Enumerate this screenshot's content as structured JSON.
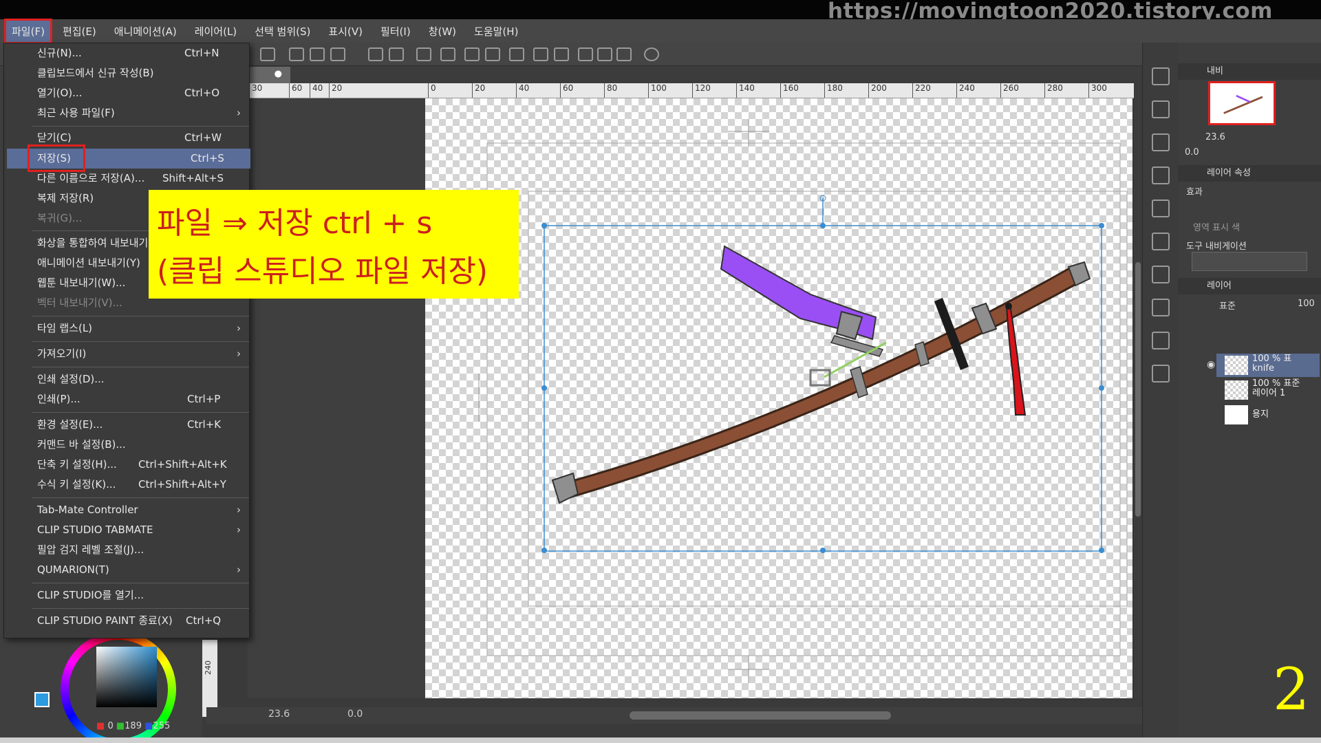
{
  "watermark": "https://movingtoon2020.tistory.com",
  "menubar": {
    "items": [
      "파일(F)",
      "편집(E)",
      "애니메이션(A)",
      "레이어(L)",
      "선택 범위(S)",
      "표시(V)",
      "필터(I)",
      "창(W)",
      "도움말(H)"
    ],
    "active_index": 0
  },
  "file_menu": {
    "items": [
      {
        "label": "신규(N)...",
        "shortcut": "Ctrl+N"
      },
      {
        "label": "클립보드에서 신규 작성(B)",
        "shortcut": ""
      },
      {
        "label": "열기(O)...",
        "shortcut": "Ctrl+O"
      },
      {
        "label": "최근 사용 파일(F)",
        "shortcut": "",
        "submenu": true
      },
      {
        "label": "닫기(C)",
        "shortcut": "Ctrl+W"
      },
      {
        "label": "저장(S)",
        "shortcut": "Ctrl+S",
        "highlighted": true
      },
      {
        "label": "다른 이름으로 저장(A)...",
        "shortcut": "Shift+Alt+S"
      },
      {
        "label": "복제 저장(R)",
        "shortcut": ""
      },
      {
        "label": "복귀(G)...",
        "shortcut": "",
        "disabled": true
      },
      {
        "label": "화상을 통합하여 내보내기",
        "shortcut": ""
      },
      {
        "label": "애니메이션 내보내기(Y)",
        "shortcut": ""
      },
      {
        "label": "웹툰 내보내기(W)...",
        "shortcut": ""
      },
      {
        "label": "벡터 내보내기(V)...",
        "shortcut": "",
        "disabled": true
      },
      {
        "label": "타임 랩스(L)",
        "shortcut": "",
        "submenu": true
      },
      {
        "label": "가져오기(I)",
        "shortcut": "",
        "submenu": true
      },
      {
        "label": "인쇄 설정(D)...",
        "shortcut": ""
      },
      {
        "label": "인쇄(P)...",
        "shortcut": "Ctrl+P"
      },
      {
        "label": "환경 설정(E)...",
        "shortcut": "Ctrl+K"
      },
      {
        "label": "커맨드 바 설정(B)...",
        "shortcut": ""
      },
      {
        "label": "단축 키 설정(H)...",
        "shortcut": "Ctrl+Shift+Alt+K"
      },
      {
        "label": "수식 키 설정(K)...",
        "shortcut": "Ctrl+Shift+Alt+Y"
      },
      {
        "label": "Tab-Mate Controller",
        "shortcut": "",
        "submenu": true
      },
      {
        "label": "CLIP STUDIO TABMATE",
        "shortcut": "",
        "submenu": true
      },
      {
        "label": "필압 검지 레벨 조절(J)...",
        "shortcut": ""
      },
      {
        "label": "QUMARION(T)",
        "shortcut": "",
        "submenu": true
      },
      {
        "label": "CLIP STUDIO를 열기...",
        "shortcut": ""
      },
      {
        "label": "CLIP STUDIO PAINT 종료(X)",
        "shortcut": "Ctrl+Q"
      }
    ]
  },
  "callout": {
    "line1": "파일 ⇒ 저장 ctrl + s",
    "line2": "(클립 스튜디오 파일 저장)"
  },
  "ruler_ticks": [
    "30",
    "60",
    "40",
    "20",
    "0",
    "20",
    "40",
    "60",
    "80",
    "100",
    "120",
    "140",
    "160",
    "180",
    "200",
    "220",
    "240",
    "260",
    "280",
    "300"
  ],
  "vertical_ruler": "240",
  "canvas_bottom": {
    "zoom": "23.6",
    "rotation": "0.0"
  },
  "color": {
    "r": "0",
    "g": "189",
    "b": "255",
    "main": "#2d9be0"
  },
  "navigator": {
    "label": "내비",
    "zoom": "23.6",
    "angle": "0.0"
  },
  "layer_property": {
    "header": "레이어 속성",
    "effect": "효과",
    "area_color": "영역 표시 색",
    "tool_nav": "도구 내비게이션"
  },
  "layer_panel": {
    "header": "레이어",
    "blend": "표준",
    "opacity": "100",
    "layers": [
      {
        "line1": "100 % 표",
        "line2": "knife",
        "selected": true
      },
      {
        "line1": "100 % 표준",
        "line2": "레이어 1",
        "selected": false
      },
      {
        "line1": "",
        "line2": "용지",
        "selected": false
      }
    ]
  },
  "page_number": "2",
  "colors": {
    "scabbard": "#8b4f35",
    "hilt": "#9a4ff5",
    "cord": "#d9141c",
    "metal": "#8f8f8f"
  }
}
